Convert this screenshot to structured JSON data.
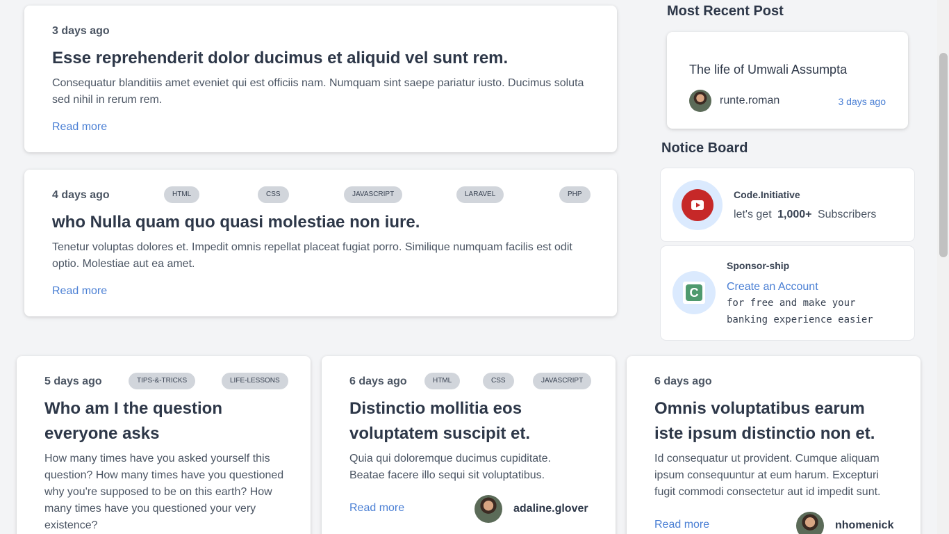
{
  "posts": [
    {
      "time": "3 days ago",
      "title": "Esse reprehenderit dolor ducimus et aliquid vel sunt rem.",
      "excerpt": "Consequatur blanditiis amet eveniet qui est officiis nam. Numquam sint saepe pariatur iusto. Ducimus soluta sed nihil in rerum rem.",
      "read_more": "Read more",
      "tags": []
    },
    {
      "time": "4 days ago",
      "title": "who Nulla quam quo quasi molestiae non iure.",
      "excerpt": "Tenetur voluptas dolores et. Impedit omnis repellat placeat fugiat porro. Similique numquam facilis est odit optio. Molestiae aut ea amet.",
      "read_more": "Read more",
      "tags": [
        "HTML",
        "CSS",
        "JAVASCRIPT",
        "LARAVEL",
        "PHP"
      ]
    }
  ],
  "grid_posts": [
    {
      "time": "5 days ago",
      "title": "Who am I the question everyone asks",
      "excerpt": "How many times have you asked yourself this question? How many times have you questioned why you're supposed to be on this earth? How many times have you questioned your very existence?",
      "tags": [
        "TIPS-&-TRICKS",
        "LIFE-LESSONS"
      ]
    },
    {
      "time": "6 days ago",
      "title": "Distinctio mollitia eos voluptatem suscipit et.",
      "excerpt": "Quia qui doloremque ducimus cupiditate. Beatae facere illo sequi sit voluptatibus.",
      "read_more": "Read more",
      "author": "adaline.glover",
      "tags": [
        "HTML",
        "CSS",
        "JAVASCRIPT"
      ]
    },
    {
      "time": "6 days ago",
      "title": "Omnis voluptatibus earum iste ipsum distinctio non et.",
      "excerpt": "Id consequatur ut provident. Cumque aliquam ipsum consequuntur at eum harum. Excepturi fugit commodi consectetur aut id impedit sunt.",
      "read_more": "Read more",
      "author": "nhomenick",
      "tags": []
    }
  ],
  "sidebar": {
    "recent_heading": "Most Recent Post",
    "recent_post": {
      "title": "The life of Umwali Assumpta",
      "author": "runte.roman",
      "time": "3 days ago"
    },
    "notice_heading": "Notice Board",
    "notices": {
      "youtube": {
        "name": "Code.Initiative",
        "prefix": "let's get",
        "count": "1,000+",
        "suffix": "Subscribers"
      },
      "sponsor": {
        "name": "Sponsor-ship",
        "link": "Create an Account",
        "text_line1": "for free and make your",
        "text_line2": "banking experience easier"
      }
    }
  },
  "colors": {
    "background": "#f3f4f6",
    "link": "#4a7fd4",
    "youtube_red": "#c62828",
    "sponsor_green": "#4f9a6e"
  }
}
